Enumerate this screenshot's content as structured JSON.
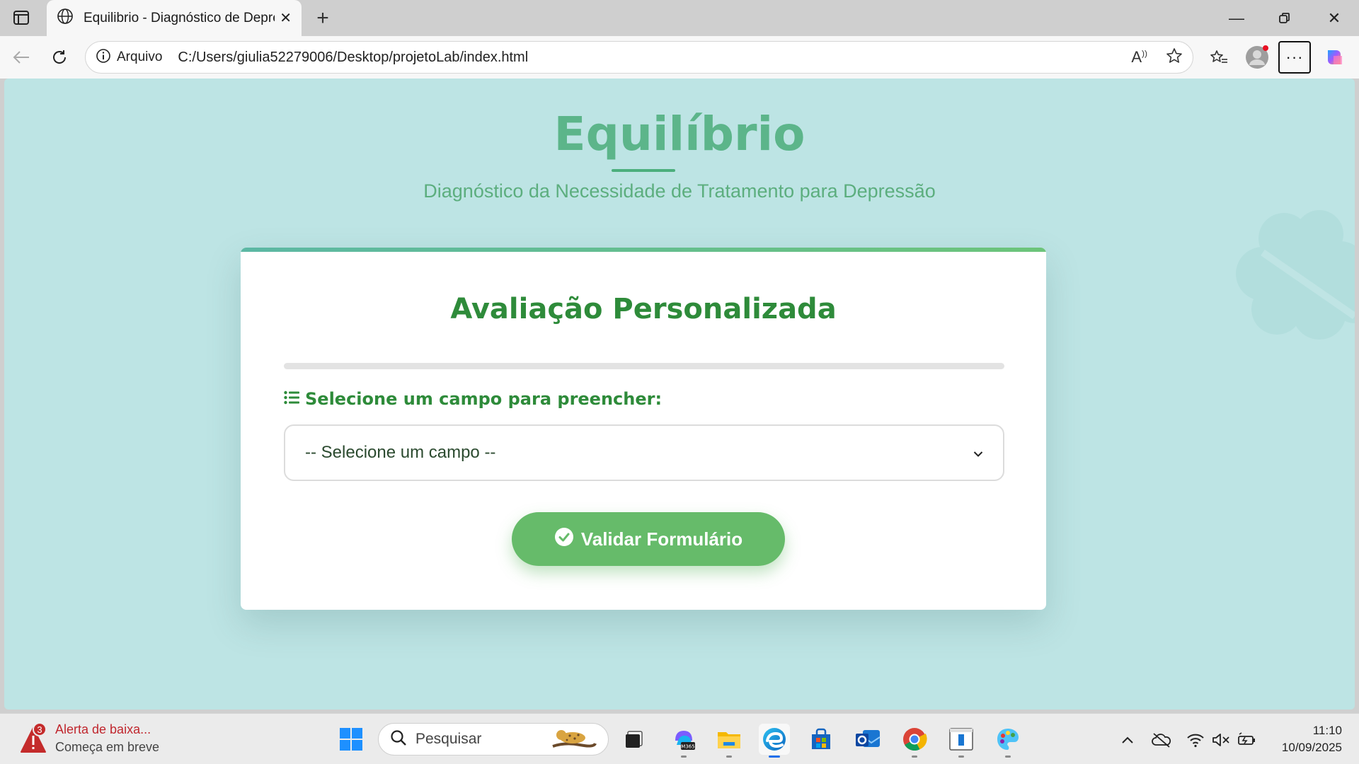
{
  "browser": {
    "tab_title": "Equilibrio - Diagnóstico de Depressão",
    "omnibox_label": "Arquivo",
    "url": "C:/Users/giulia52279006/Desktop/projetoLab/index.html"
  },
  "page": {
    "brand": "Equilíbrio",
    "subtitle": "Diagnóstico da Necessidade de Tratamento para Depressão",
    "card": {
      "title": "Avaliação Personalizada",
      "progress_fraction": 0,
      "field_label": "Selecione um campo para preencher:",
      "select_value": "-- Selecione um campo --",
      "submit_label": "Validar Formulário"
    }
  },
  "taskbar": {
    "notification": {
      "badge": "3",
      "title": "Alerta de baixa...",
      "subtitle": "Começa em breve"
    },
    "search_placeholder": "Pesquisar",
    "clock_time": "11:10",
    "clock_date": "10/09/2025"
  },
  "colors": {
    "page_bg": "#bde4e4",
    "brand": "#5cb58a",
    "accent_green": "#66bb6a",
    "title_green": "#2e8b3a"
  }
}
